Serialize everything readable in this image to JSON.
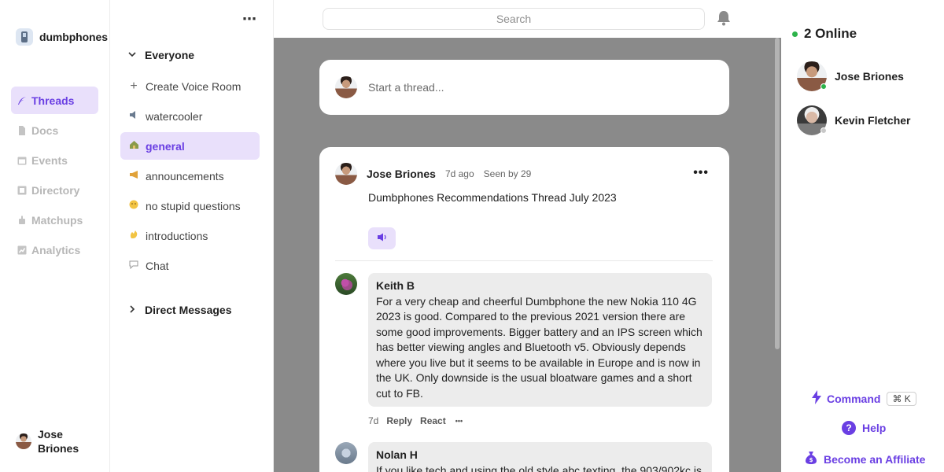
{
  "brand": {
    "name": "dumbphones",
    "icon": "phone-icon"
  },
  "nav": {
    "items": [
      {
        "label": "Threads",
        "icon": "feather-icon",
        "active": true
      },
      {
        "label": "Docs",
        "icon": "doc-icon",
        "active": false
      },
      {
        "label": "Events",
        "icon": "calendar-icon",
        "active": false
      },
      {
        "label": "Directory",
        "icon": "directory-icon",
        "active": false
      },
      {
        "label": "Matchups",
        "icon": "matchups-icon",
        "active": false
      },
      {
        "label": "Analytics",
        "icon": "analytics-icon",
        "active": false
      }
    ],
    "user": "Jose Briones"
  },
  "channels": {
    "section_label": "Everyone",
    "items": [
      {
        "label": "Create Voice Room",
        "icon": "plus-icon"
      },
      {
        "label": "watercooler",
        "icon": "speaker-emoji"
      },
      {
        "label": "general",
        "icon": "house-emoji",
        "active": true
      },
      {
        "label": "announcements",
        "icon": "megaphone-emoji"
      },
      {
        "label": "no stupid questions",
        "icon": "thinking-emoji"
      },
      {
        "label": "introductions",
        "icon": "wave-emoji"
      },
      {
        "label": "Chat",
        "icon": "speech-bubble-emoji"
      }
    ],
    "dm_label": "Direct Messages"
  },
  "search": {
    "placeholder": "Search"
  },
  "composer": {
    "placeholder": "Start a thread..."
  },
  "post": {
    "author": "Jose Briones",
    "time": "7d ago",
    "seen": "Seen by 29",
    "title": "Dumbphones Recommendations Thread July 2023",
    "reaction_icon": "speaker-emoji"
  },
  "comments": [
    {
      "author": "Keith B",
      "text": "For a very cheap and cheerful Dumbphone the new Nokia 110 4G 2023 is good. Compared to the previous 2021 version there are some good improvements. Bigger battery and an IPS screen which has better viewing angles and Bluetooth v5. Obviously depends where you live but it seems to be available in Europe and is now in the UK. Only downside is the usual bloatware games and a short cut to FB.",
      "time": "7d",
      "reply": "Reply",
      "react": "React",
      "more": "•••"
    },
    {
      "author": "Nolan H",
      "text": "If you like tech and using the old style abc texting, the 903/902kc is"
    }
  ],
  "online": {
    "label": "2 Online",
    "users": [
      {
        "name": "Jose Briones",
        "status": "online",
        "status_color": "#2db34a"
      },
      {
        "name": "Kevin Fletcher",
        "status": "away",
        "status_color": "#c8c8c8"
      }
    ]
  },
  "footer": {
    "command": "Command",
    "shortcut": "⌘ K",
    "help": "Help",
    "affiliate": "Become an Affiliate"
  },
  "colors": {
    "accent": "#6a3fe3",
    "accent_bg": "#e9e0fb",
    "feed_bg": "#8a8a8a"
  }
}
